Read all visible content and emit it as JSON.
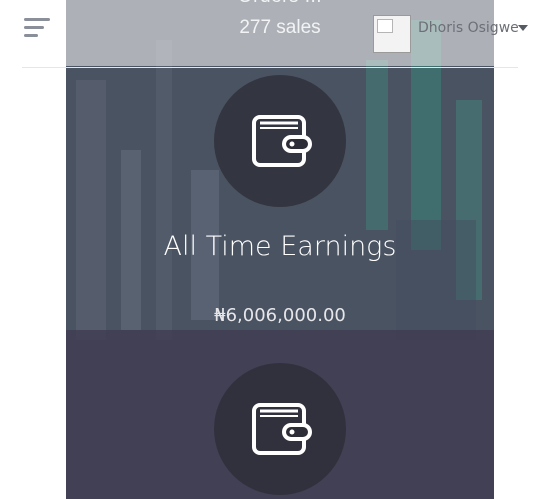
{
  "header": {
    "user_name": "Dhoris Osigwe"
  },
  "card": {
    "partial_title_above": "Orders ...",
    "sales_count_text": "277 sales",
    "all_time_title": "All Time Earnings",
    "all_time_amount": "₦6,006,000.00"
  },
  "icons": {
    "menu": "hamburger-icon",
    "wallet": "wallet-icon",
    "dropdown": "caret-down-icon"
  },
  "colors": {
    "icon_circle": "#2d2d37",
    "text_light": "#ffffff",
    "username": "#6d6f77"
  }
}
